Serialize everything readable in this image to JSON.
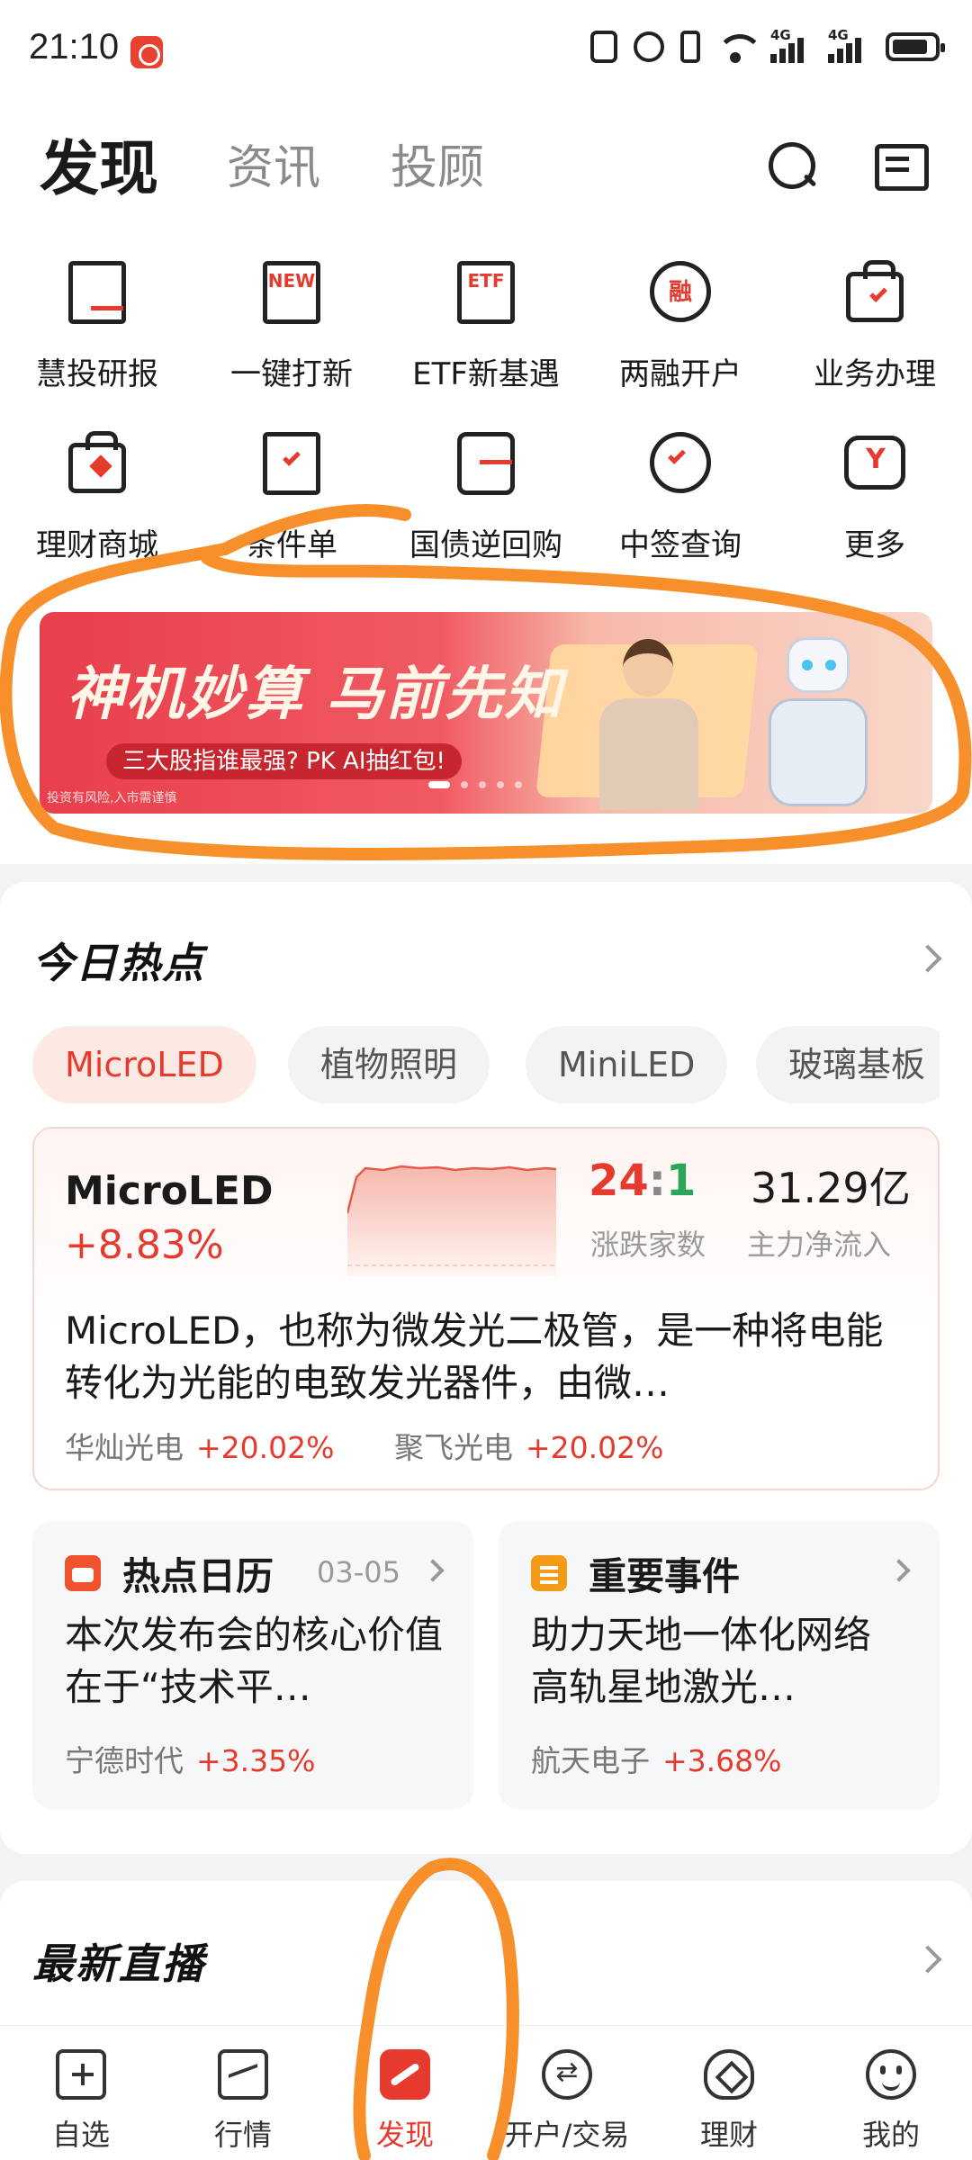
{
  "status_bar": {
    "time": "21:10",
    "icons": [
      "nfc-icon",
      "alarm-icon",
      "vibrate-icon",
      "wifi-icon",
      "signal-4g-icon",
      "signal-4g-icon",
      "battery-icon"
    ],
    "network_label_1": "4G",
    "network_label_2": "4G"
  },
  "header": {
    "tabs": [
      {
        "label": "发现",
        "active": true
      },
      {
        "label": "资讯",
        "active": false
      },
      {
        "label": "投顾",
        "active": false
      }
    ],
    "search_icon": "search-icon",
    "message_icon": "message-icon"
  },
  "quick_grid": {
    "items": [
      {
        "label": "慧投研报",
        "icon": "report-icon"
      },
      {
        "label": "一键打新",
        "icon": "new-icon",
        "badge": "NEW"
      },
      {
        "label": "ETF新基遇",
        "icon": "etf-icon",
        "badge": "ETF"
      },
      {
        "label": "两融开户",
        "icon": "margin-icon",
        "badge": "融"
      },
      {
        "label": "业务办理",
        "icon": "business-icon"
      },
      {
        "label": "理财商城",
        "icon": "wealth-mall-icon"
      },
      {
        "label": "条件单",
        "icon": "conditional-order-icon"
      },
      {
        "label": "国债逆回购",
        "icon": "reverse-repo-icon"
      },
      {
        "label": "中签查询",
        "icon": "lottery-query-icon"
      },
      {
        "label": "更多",
        "icon": "more-icon",
        "badge": "Y"
      }
    ]
  },
  "banner": {
    "title": "神机妙算 马前先知",
    "subtitle": "三大股指谁最强? PK AI抽红包!",
    "risk": "投资有风险,入市需谨慎",
    "slide_count": 5,
    "active_slide": 0
  },
  "hot_topics": {
    "title": "今日热点",
    "chips": [
      {
        "label": "MicroLED",
        "active": true
      },
      {
        "label": "植物照明",
        "active": false
      },
      {
        "label": "MiniLED",
        "active": false
      },
      {
        "label": "玻璃基板",
        "active": false
      }
    ],
    "main": {
      "name": "MicroLED",
      "change": "+8.83%",
      "rise": "24",
      "separator": ":",
      "fall": "1",
      "rise_fall_label": "涨跌家数",
      "net_inflow": "31.29亿",
      "net_inflow_label": "主力净流入",
      "description": "MicroLED，也称为微发光二极管，是一种将电能转化为光能的电致发光器件，由微…",
      "stocks": [
        {
          "name": "华灿光电",
          "change": "+20.02%"
        },
        {
          "name": "聚飞光电",
          "change": "+20.02%"
        }
      ]
    },
    "calendar": {
      "title": "热点日历",
      "date": "03-05",
      "text": "本次发布会的核心价值在于“技术平…",
      "stock_name": "宁德时代",
      "stock_change": "+3.35%"
    },
    "event": {
      "title": "重要事件",
      "text": "助力天地一体化网络 高轨星地激光…",
      "stock_name": "航天电子",
      "stock_change": "+3.68%"
    }
  },
  "live": {
    "title": "最新直播"
  },
  "bottom_nav": {
    "items": [
      {
        "label": "自选",
        "icon": "watchlist-icon",
        "active": false
      },
      {
        "label": "行情",
        "icon": "market-icon",
        "active": false
      },
      {
        "label": "发现",
        "icon": "discover-icon",
        "active": true
      },
      {
        "label": "开户/交易",
        "icon": "trade-icon",
        "active": false
      },
      {
        "label": "理财",
        "icon": "wealth-icon",
        "active": false
      },
      {
        "label": "我的",
        "icon": "profile-icon",
        "active": false
      }
    ]
  },
  "colors": {
    "accent": "#e63a2e",
    "fall": "#2aa55b",
    "annotation": "#f7902a"
  }
}
